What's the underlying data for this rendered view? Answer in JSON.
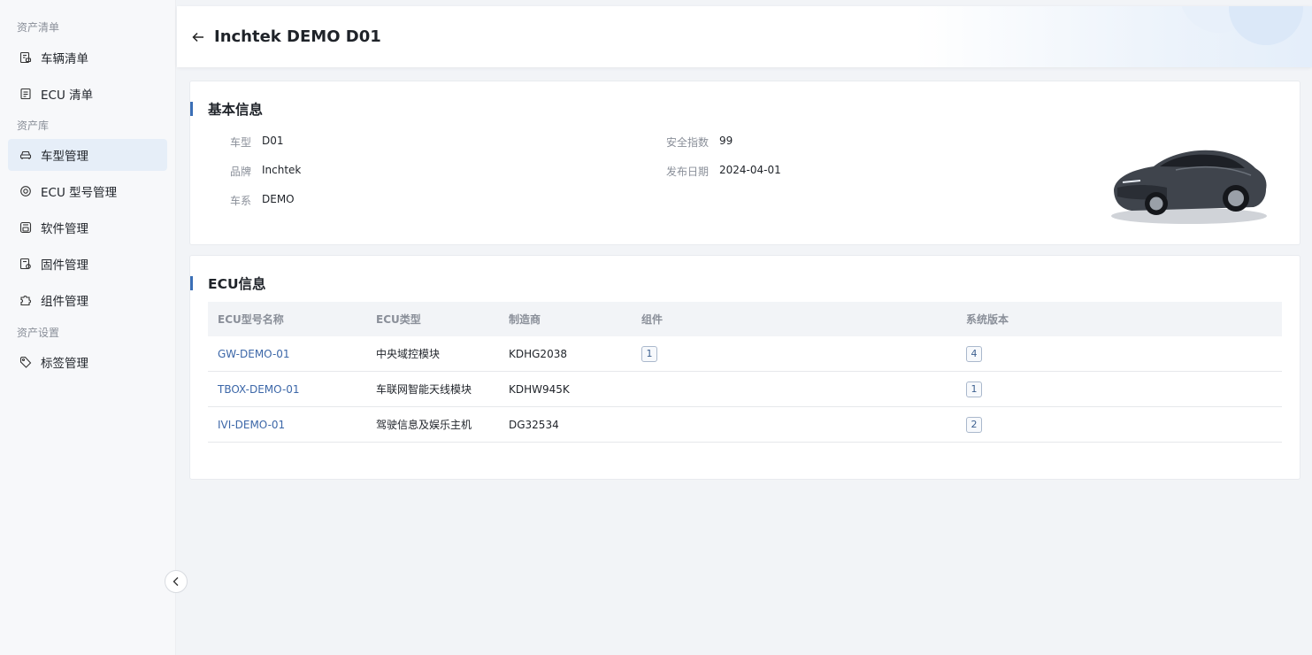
{
  "sidebar": {
    "groups": [
      {
        "title": "资产清单"
      },
      {
        "title": "资产库"
      },
      {
        "title": "资产设置"
      }
    ],
    "items": [
      {
        "label": "车辆清单",
        "icon": "vehicle-list-icon"
      },
      {
        "label": "ECU 清单",
        "icon": "document-list-icon"
      },
      {
        "label": "车型管理",
        "icon": "car-icon",
        "active": true
      },
      {
        "label": "ECU 型号管理",
        "icon": "chip-settings-icon"
      },
      {
        "label": "软件管理",
        "icon": "software-icon"
      },
      {
        "label": "固件管理",
        "icon": "firmware-icon"
      },
      {
        "label": "组件管理",
        "icon": "component-icon"
      },
      {
        "label": "标签管理",
        "icon": "tag-icon"
      }
    ]
  },
  "header": {
    "title": "Inchtek DEMO D01"
  },
  "basic_info": {
    "title": "基本信息",
    "fields": [
      {
        "label": "车型",
        "value": "D01"
      },
      {
        "label": "品牌",
        "value": "Inchtek"
      },
      {
        "label": "车系",
        "value": "DEMO"
      },
      {
        "label": "安全指数",
        "value": "99"
      },
      {
        "label": "发布日期",
        "value": "2024-04-01"
      }
    ]
  },
  "ecu_info": {
    "title": "ECU信息",
    "columns": [
      "ECU型号名称",
      "ECU类型",
      "制造商",
      "组件",
      "系统版本"
    ],
    "rows": [
      {
        "name": "GW-DEMO-01",
        "type": "中央域控模块",
        "maker": "KDHG2038",
        "components": "1",
        "versions": "4"
      },
      {
        "name": "TBOX-DEMO-01",
        "type": "车联网智能天线模块",
        "maker": "KDHW945K",
        "components": "",
        "versions": "1"
      },
      {
        "name": "IVI-DEMO-01",
        "type": "驾驶信息及娱乐主机",
        "maker": "DG32534",
        "components": "",
        "versions": "2"
      }
    ]
  },
  "colors": {
    "accent": "#3b6fb6",
    "link": "#3c67a8",
    "active_bg": "#e6eef8"
  }
}
